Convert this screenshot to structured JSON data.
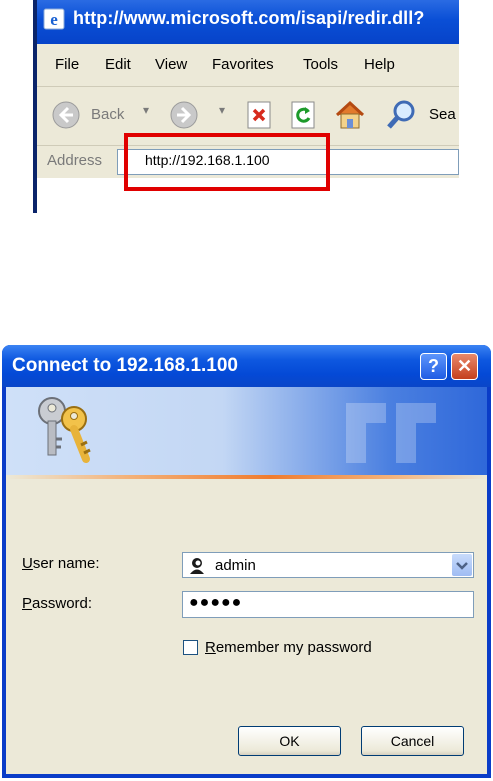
{
  "browser": {
    "title": "http://www.microsoft.com/isapi/redir.dll?",
    "menu": [
      "File",
      "Edit",
      "View",
      "Favorites",
      "Tools",
      "Help"
    ],
    "toolbar": {
      "back_label": "Back",
      "search_label": "Sea"
    },
    "address": {
      "label": "Address",
      "value": "http://192.168.1.100"
    },
    "icons": [
      "ie-icon",
      "back-icon",
      "forward-icon",
      "stop-icon",
      "refresh-icon",
      "home-icon",
      "search-icon"
    ]
  },
  "dialog": {
    "title": "Connect to 192.168.1.100",
    "help_glyph": "?",
    "close_glyph": "✕",
    "username": {
      "label_prefix": "U",
      "label_rest": "ser name:",
      "value": "admin"
    },
    "password": {
      "label_prefix": "P",
      "label_rest": "assword:",
      "value": "●●●●●"
    },
    "remember": {
      "label_prefix": "R",
      "label_rest": "emember my password",
      "checked": false
    },
    "ok_label": "OK",
    "cancel_label": "Cancel",
    "icons": [
      "keys-icon",
      "user-icon",
      "dropdown-arrow-icon"
    ]
  },
  "colors": {
    "highlight": "#e00000",
    "titlebar": "#0a4fd6",
    "dialog_face": "#ece9d8"
  }
}
